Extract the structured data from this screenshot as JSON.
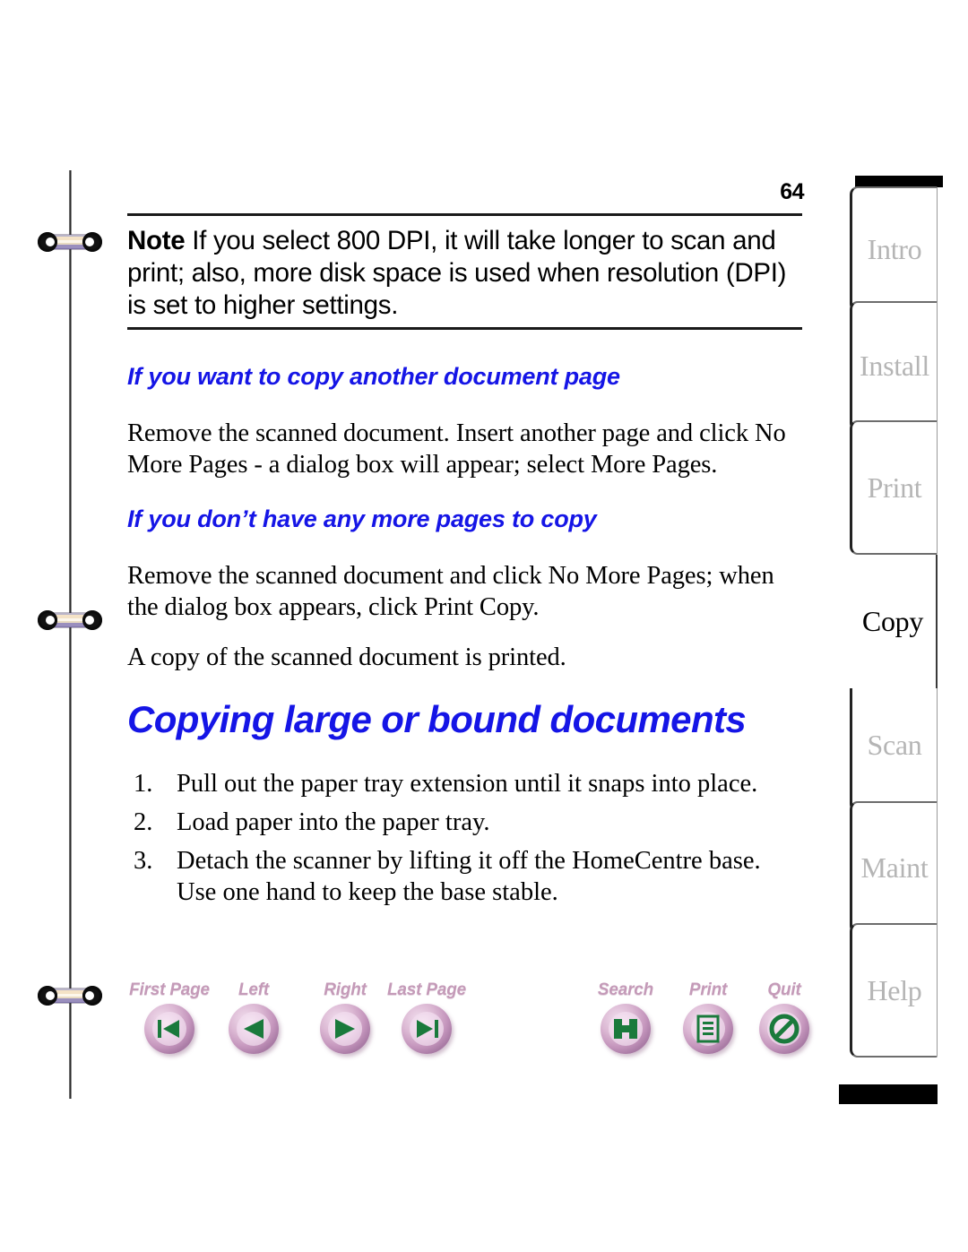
{
  "page": {
    "number": "64"
  },
  "note": {
    "label": "Note",
    "text": "If you select 800 DPI, it will take longer to scan and print; also, more disk space is used when resolution (DPI) is set to higher settings."
  },
  "sections": [
    {
      "heading": "If you want to copy another document page",
      "body": "Remove the scanned document. Insert another page and click No More Pages - a dialog box will appear; select More Pages."
    },
    {
      "heading": "If you don’t have any more pages to copy",
      "body": "Remove the scanned document and click No More Pages; when the dialog box appears, click Print Copy.",
      "body2": "A copy of the scanned document is printed."
    }
  ],
  "main_title": "Copying large or bound documents",
  "steps": [
    {
      "num": "1.",
      "text": "Pull out the paper tray extension until it snaps into place."
    },
    {
      "num": "2.",
      "text": "Load paper into the paper tray."
    },
    {
      "num": "3.",
      "text": "Detach the scanner by lifting it off the HomeCentre base. Use one hand to keep the base stable."
    }
  ],
  "nav": {
    "buttons": [
      {
        "label": "First Page",
        "icon": "first-page-icon"
      },
      {
        "label": "Left",
        "icon": "previous-page-icon"
      },
      {
        "label": "Right",
        "icon": "next-page-icon"
      },
      {
        "label": "Last Page",
        "icon": "last-page-icon"
      },
      {
        "label": "Search",
        "icon": "search-icon"
      },
      {
        "label": "Print",
        "icon": "print-icon"
      },
      {
        "label": "Quit",
        "icon": "quit-icon"
      }
    ]
  },
  "tabs": [
    {
      "label": "Intro",
      "active": false
    },
    {
      "label": "Install",
      "active": false
    },
    {
      "label": "Print",
      "active": false
    },
    {
      "label": "Copy",
      "active": true
    },
    {
      "label": "Scan",
      "active": false
    },
    {
      "label": "Maint",
      "active": false
    },
    {
      "label": "Help",
      "active": false
    }
  ],
  "colors": {
    "heading_blue": "#1515e6",
    "nav_label": "#c49ab8",
    "glyph_green": "#1a7a3c",
    "tab_inactive_text": "#b5b5b5"
  }
}
